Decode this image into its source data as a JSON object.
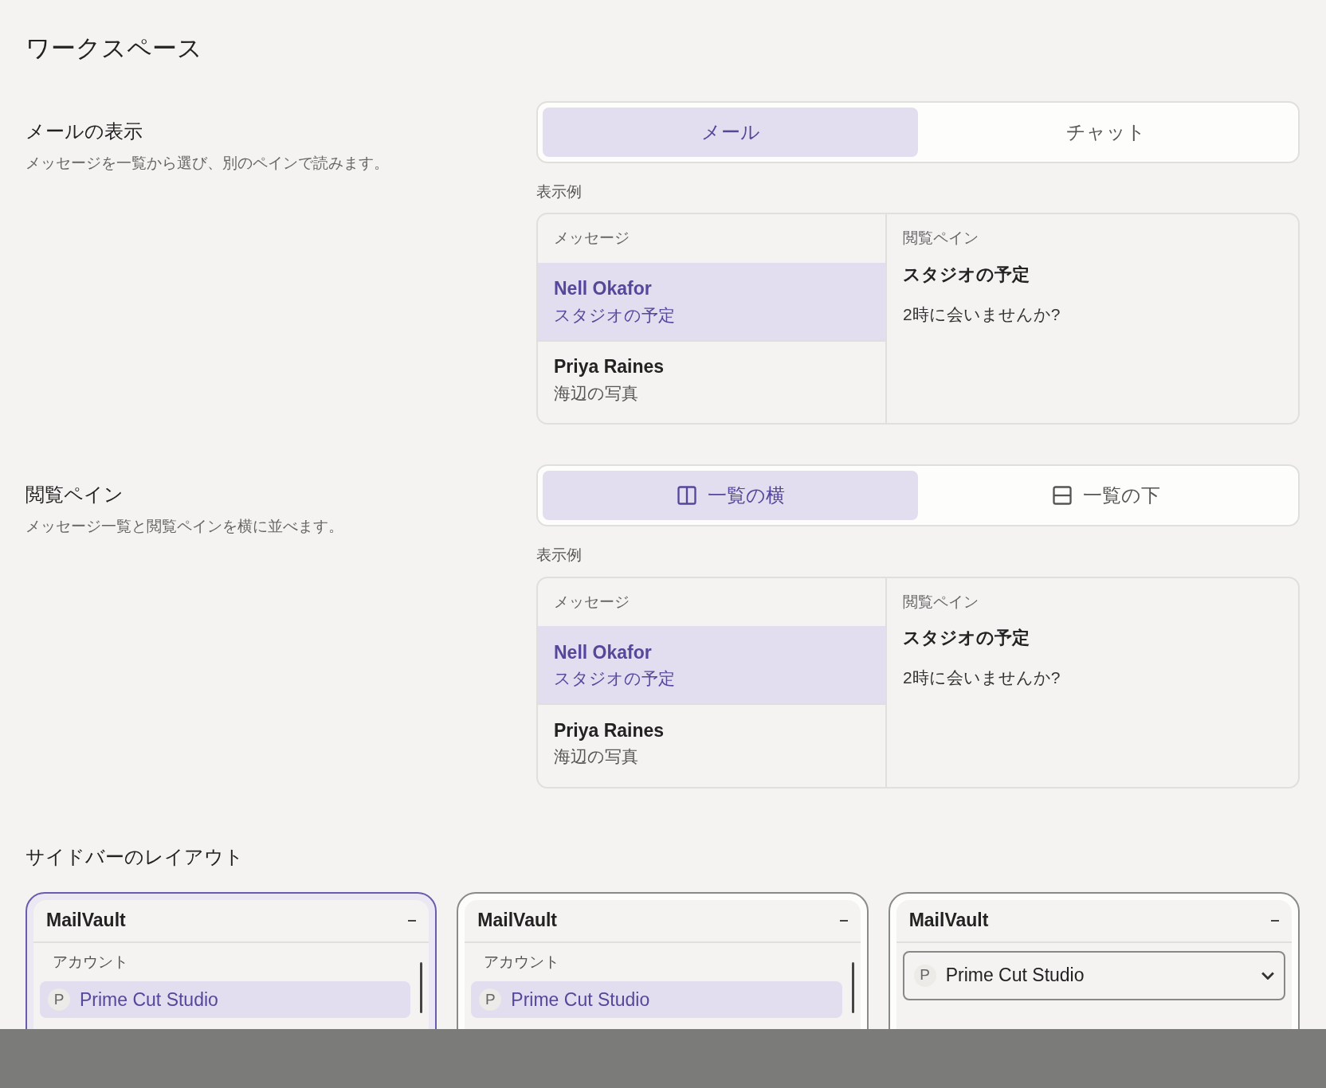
{
  "title": "ワークスペース",
  "sections": [
    {
      "heading": "メールの表示",
      "description": "メッセージを一覧から選び、別のペインで読みます。",
      "options": [
        {
          "label": "メール",
          "selected": true,
          "kind": "plain"
        },
        {
          "label": "チャット",
          "selected": false,
          "kind": "plain"
        }
      ],
      "preview_label": "表示例",
      "preview": {
        "list_header": "メッセージ",
        "messages": [
          {
            "sender": "Nell Okafor",
            "subject": "スタジオの予定",
            "selected": true
          },
          {
            "sender": "Priya Raines",
            "subject": "海辺の写真",
            "selected": false
          }
        ],
        "pane_header": "閲覧ペイン",
        "pane_subject": "スタジオの予定",
        "pane_body": "2時に会いませんか?"
      }
    },
    {
      "heading": "閲覧ペイン",
      "description": "メッセージ一覧と閲覧ペインを横に並べます。",
      "options": [
        {
          "label": "一覧の横",
          "selected": true,
          "kind": "columns"
        },
        {
          "label": "一覧の下",
          "selected": false,
          "kind": "rows"
        }
      ],
      "preview_label": "表示例",
      "preview": {
        "list_header": "メッセージ",
        "messages": [
          {
            "sender": "Nell Okafor",
            "subject": "スタジオの予定",
            "selected": true
          },
          {
            "sender": "Priya Raines",
            "subject": "海辺の写真",
            "selected": false
          }
        ],
        "pane_header": "閲覧ペイン",
        "pane_subject": "スタジオの予定",
        "pane_body": "2時に会いませんか?"
      }
    }
  ],
  "sidebar_layout": {
    "heading": "サイドバーのレイアウト",
    "cards": [
      {
        "kind": "list",
        "selected": true,
        "app_name": "MailVault",
        "section_label": "アカウント",
        "account": {
          "initial": "P",
          "name": "Prime Cut Studio",
          "selected": true
        }
      },
      {
        "kind": "list",
        "selected": false,
        "app_name": "MailVault",
        "section_label": "アカウント",
        "account": {
          "initial": "P",
          "name": "Prime Cut Studio",
          "selected": true
        }
      },
      {
        "kind": "dropdown",
        "selected": false,
        "app_name": "MailVault",
        "account": {
          "initial": "P",
          "name": "Prime Cut Studio"
        }
      }
    ]
  }
}
